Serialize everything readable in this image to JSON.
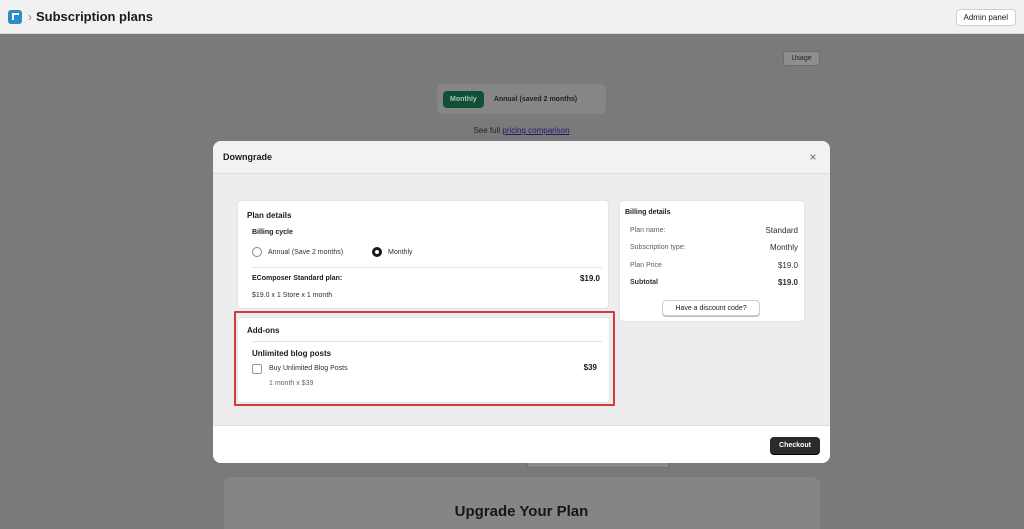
{
  "topbar": {
    "breadcrumb_sep": "›",
    "title": "Subscription plans",
    "admin_label": "Admin panel"
  },
  "background": {
    "usage_label": "Usage",
    "cycle_monthly": "Monthly",
    "cycle_annual": "Annual (saved 2 months)",
    "pricing_prefix": "See full ",
    "pricing_link": "pricing comparison",
    "upgrade_title": "Upgrade Your Plan"
  },
  "modal": {
    "title": "Downgrade",
    "close_glyph": "×",
    "plan": {
      "title": "Plan details",
      "billing_cycle_label": "Billing cycle",
      "option_annual": "Annual (Save 2 months)",
      "option_monthly": "Monthly",
      "selected": "Monthly",
      "plan_name_label": "EComposer Standard plan:",
      "plan_price": "$19.0",
      "plan_breakdown": "$19.0 x 1 Store x 1 month"
    },
    "addons": {
      "title": "Add-ons",
      "item_title": "Unlimited blog posts",
      "item_checkbox_label": "Buy Unlimited Blog Posts",
      "item_checked": false,
      "item_price": "$39",
      "item_breakdown": "1 month x $39"
    },
    "billing": {
      "title": "Billing details",
      "rows": [
        {
          "label": "Plan name:",
          "value": "Standard"
        },
        {
          "label": "Subscription type:",
          "value": "Monthly"
        },
        {
          "label": "Plan Price",
          "value": "$19.0"
        },
        {
          "label": "Subtotal",
          "value": "$19.0"
        }
      ],
      "discount_label": "Have a discount code?"
    },
    "checkout_label": "Checkout"
  },
  "colors": {
    "brand_logo": "#2a8dc7",
    "monthly_active": "#0f4f36",
    "highlight": "#d03b3b",
    "checkout_bg": "#2b2b2b"
  }
}
